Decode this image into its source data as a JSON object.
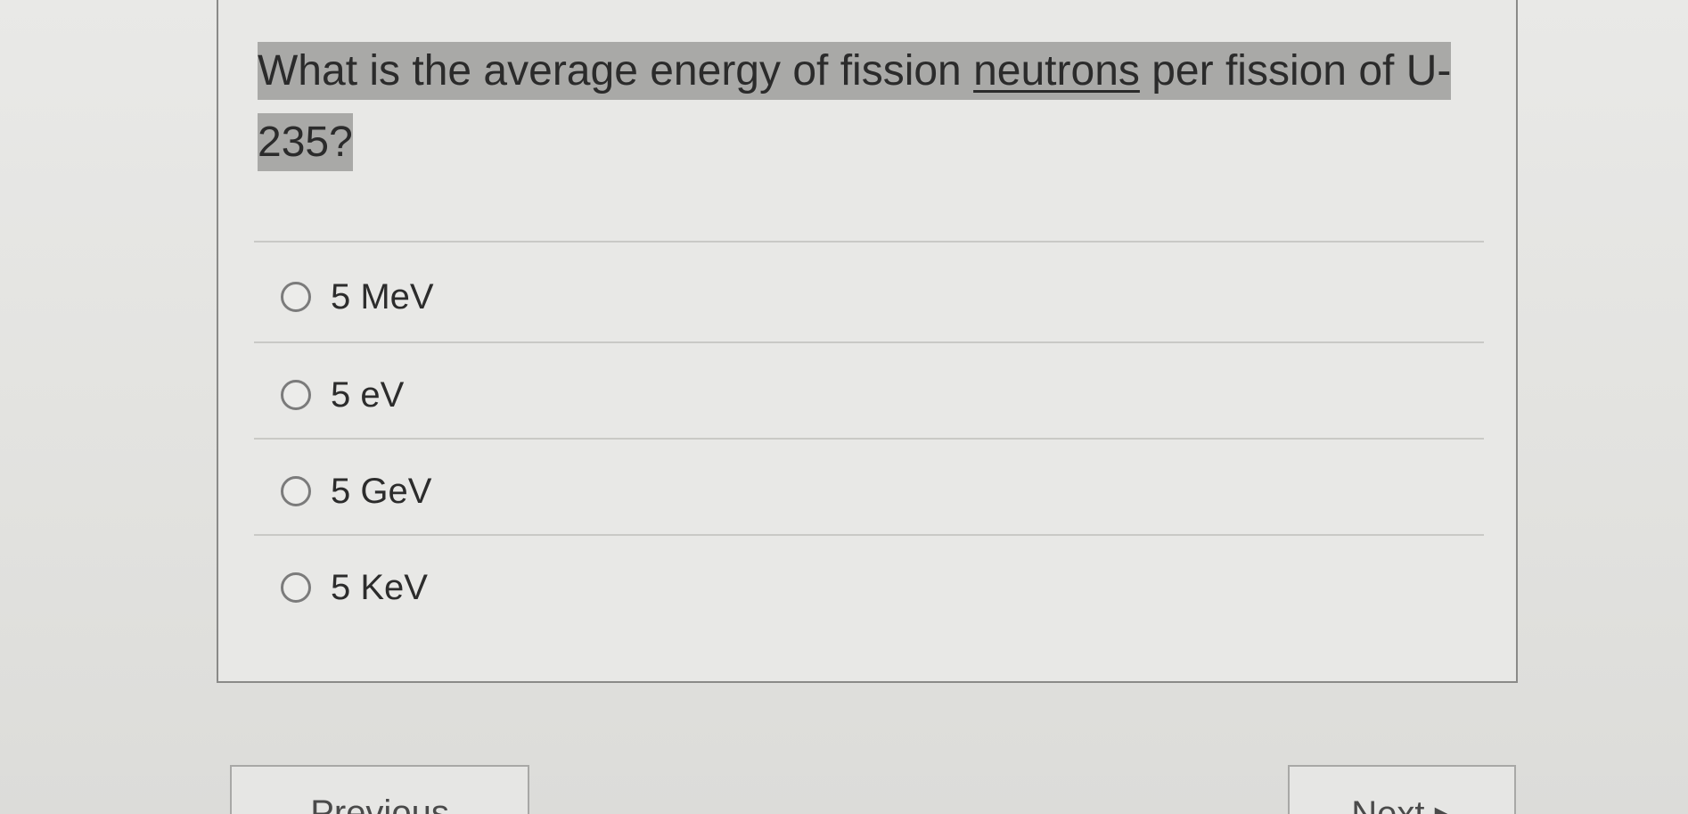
{
  "question": {
    "prefix": "What is the average energy of fission ",
    "underlined": "neutrons",
    "suffix": " per fission of U-235?"
  },
  "options": [
    {
      "label": "5 MeV"
    },
    {
      "label": "5 eV"
    },
    {
      "label": "5 GeV"
    },
    {
      "label": "5 KeV"
    }
  ],
  "nav": {
    "previous_label": "Previous",
    "next_label": "Next ▸"
  }
}
